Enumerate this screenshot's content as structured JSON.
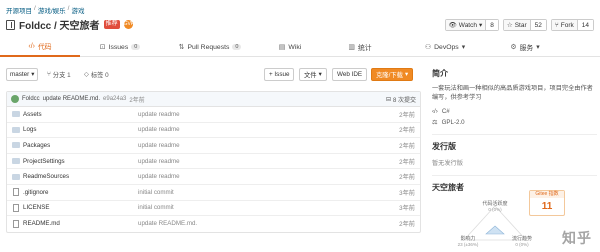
{
  "breadcrumb": [
    "开源项目",
    "游戏/娱乐",
    "游戏"
  ],
  "repo": {
    "title": "Foldcc / 天空旅者",
    "badge": "推荐",
    "gvp": "GVP"
  },
  "stats": [
    {
      "label": "Watch",
      "count": "8",
      "icon": "eye-icon"
    },
    {
      "label": "Star",
      "count": "52",
      "icon": "star-icon"
    },
    {
      "label": "Fork",
      "count": "14",
      "icon": "fork-icon"
    }
  ],
  "tabs": [
    {
      "label": "代码",
      "icon": "code-icon",
      "active": true
    },
    {
      "label": "Issues",
      "count": "0",
      "icon": "issue-icon"
    },
    {
      "label": "Pull Requests",
      "count": "0",
      "icon": "pr-icon"
    },
    {
      "label": "Wiki",
      "icon": "wiki-icon"
    },
    {
      "label": "统计",
      "icon": "stats-icon"
    },
    {
      "label": "DevOps",
      "icon": "devops-icon"
    },
    {
      "label": "服务",
      "icon": "service-icon"
    }
  ],
  "toolbar": {
    "branch": "master",
    "branches": "分支 1",
    "tags": "标签 0",
    "issue_btn": "+ Issue",
    "file_btn": "文件",
    "ide_btn": "Web IDE",
    "clone_btn": "克隆/下载"
  },
  "commit": {
    "author": "Foldcc",
    "message": "update README.md.",
    "hash": "e9a24a3",
    "ago": "2年前",
    "count": "8 次提交"
  },
  "files": [
    {
      "name": "Assets",
      "type": "dir",
      "msg": "update readme",
      "date": "2年前"
    },
    {
      "name": "Logs",
      "type": "dir",
      "msg": "update readme",
      "date": "2年前"
    },
    {
      "name": "Packages",
      "type": "dir",
      "msg": "update readme",
      "date": "2年前"
    },
    {
      "name": "ProjectSettings",
      "type": "dir",
      "msg": "update readme",
      "date": "2年前"
    },
    {
      "name": "ReadmeSources",
      "type": "dir",
      "msg": "update readme",
      "date": "2年前"
    },
    {
      "name": ".gitignore",
      "type": "file",
      "msg": "initial commit",
      "date": "3年前"
    },
    {
      "name": "LICENSE",
      "type": "file",
      "msg": "initial commit",
      "date": "3年前"
    },
    {
      "name": "README.md",
      "type": "file",
      "msg": "update README.md.",
      "date": "2年前"
    }
  ],
  "sidebar": {
    "intro_title": "简介",
    "intro_text": "一套玩法和画一种相似的高品质游戏项目，项目完全由作者编写，供参考学习",
    "language": "C#",
    "license": "GPL-2.0",
    "release_title": "发行版",
    "release_text": "暂无发行版",
    "index_title": "天空旅者",
    "index_label": "Gitee 指数",
    "index_value": "11",
    "radar_labels": [
      "代码活跃度",
      "影响力",
      "流行趋势"
    ],
    "radar_values": [
      "0 (0%)",
      "23 (±36%)",
      "0 (0%)"
    ]
  },
  "watermark": "知乎"
}
